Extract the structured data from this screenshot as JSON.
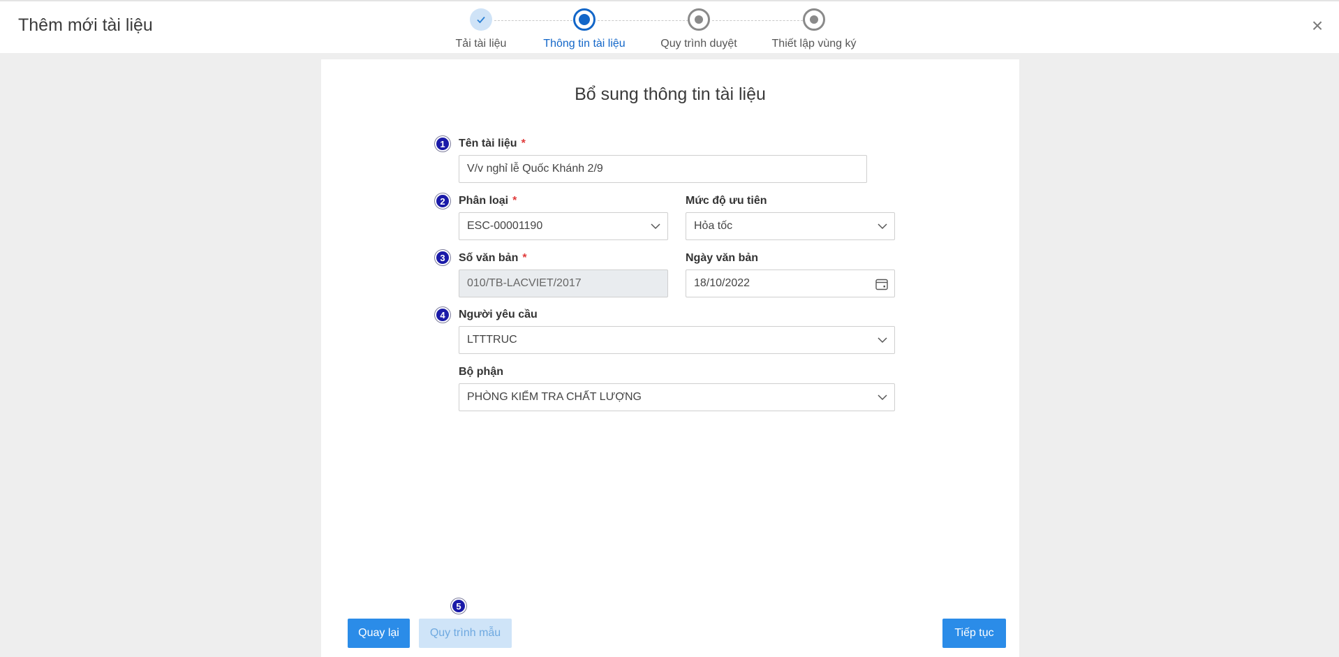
{
  "header": {
    "title": "Thêm mới tài liệu",
    "close_label": "×"
  },
  "steps": [
    {
      "label": "Tải tài liệu",
      "state": "done"
    },
    {
      "label": "Thông tin tài liệu",
      "state": "active"
    },
    {
      "label": "Quy trình duyệt",
      "state": "pending"
    },
    {
      "label": "Thiết lập vùng ký",
      "state": "pending"
    }
  ],
  "form": {
    "title": "Bổ sung thông tin tài liệu",
    "required_mark": "*",
    "markers": [
      "1",
      "2",
      "3",
      "4",
      "5"
    ],
    "doc_name": {
      "label": "Tên tài liệu",
      "value": "V/v nghỉ lễ Quốc Khánh 2/9"
    },
    "category": {
      "label": "Phân loại",
      "value": "ESC-00001190"
    },
    "priority": {
      "label": "Mức độ ưu tiên",
      "value": "Hỏa tốc"
    },
    "doc_number": {
      "label": "Số văn bản",
      "value": "010/TB-LACVIET/2017"
    },
    "doc_date": {
      "label": "Ngày văn bản",
      "value": "18/10/2022"
    },
    "requester": {
      "label": "Người yêu cầu",
      "value": "LTTTRUC"
    },
    "department": {
      "label": "Bộ phận",
      "value": "PHÒNG KIỂM TRA CHẤT LƯỢNG"
    }
  },
  "footer": {
    "back_label": "Quay lại",
    "template_label": "Quy trình mẫu",
    "next_label": "Tiếp tục"
  },
  "colors": {
    "primary": "#2b8ce8",
    "active_step": "#1266c8",
    "badge": "#1a1aa8",
    "required": "#e03a3a"
  }
}
